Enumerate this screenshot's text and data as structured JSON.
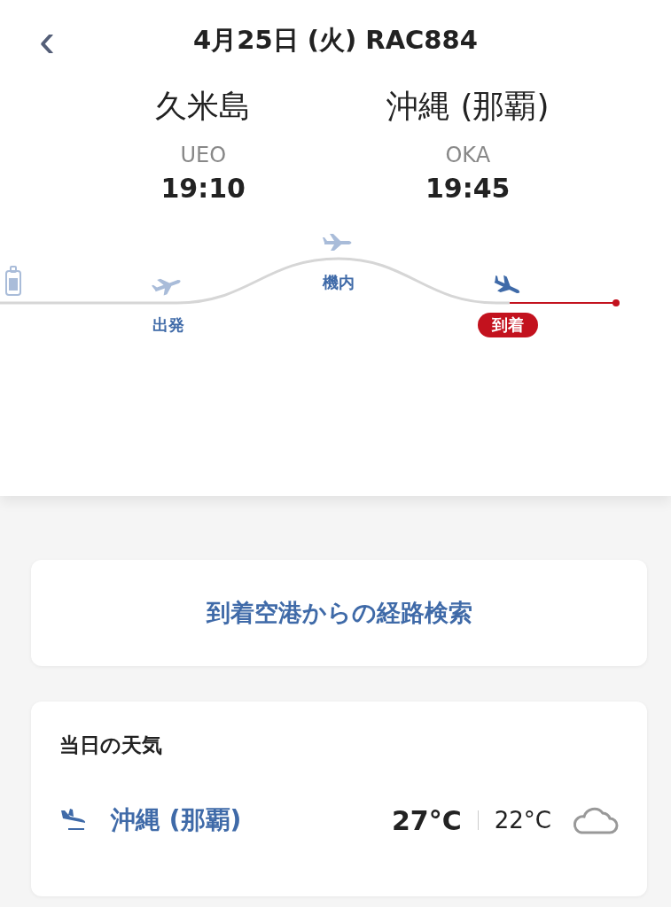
{
  "header": {
    "back": "‹",
    "title": "4月25日 (火) RAC884"
  },
  "route": [
    {
      "city": "久米島",
      "code": "UEO",
      "time": "19:10"
    },
    {
      "city": "沖縄 (那覇)",
      "code": "OKA",
      "time": "19:45"
    }
  ],
  "stages": [
    {
      "label": "出発",
      "selected": false
    },
    {
      "label": "機内",
      "selected": false
    },
    {
      "label": "到着",
      "selected": true
    }
  ],
  "route_search": {
    "label": "到着空港からの経路検索"
  },
  "weather": {
    "title": "当日の天気",
    "airport": "沖縄 (那覇)",
    "high": "27°C",
    "low": "22°C"
  }
}
